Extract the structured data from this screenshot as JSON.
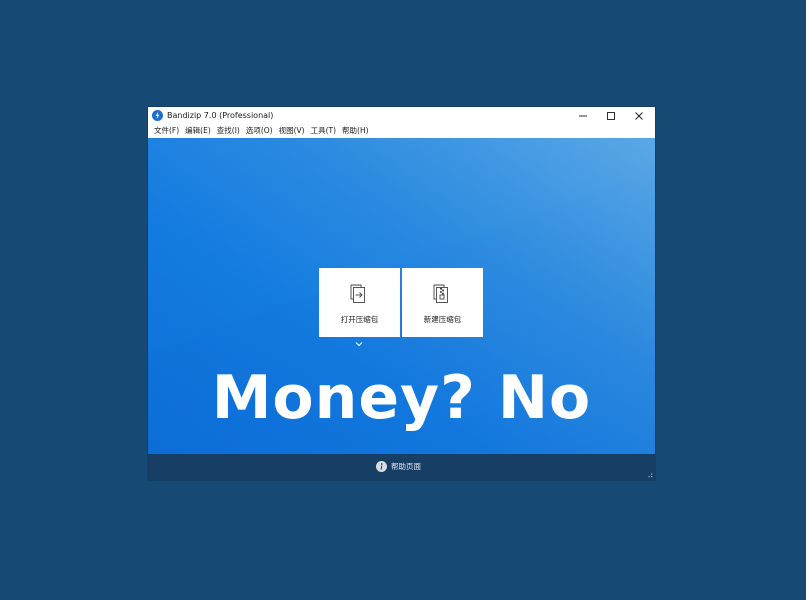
{
  "window": {
    "title": "Bandizip 7.0 (Professional)",
    "controls": {
      "minimize_icon": "minimize-icon",
      "maximize_icon": "maximize-icon",
      "close_icon": "close-icon"
    }
  },
  "menu": {
    "items": [
      {
        "label": "文件(F)"
      },
      {
        "label": "编辑(E)"
      },
      {
        "label": "查找(I)"
      },
      {
        "label": "选项(O)"
      },
      {
        "label": "视图(V)"
      },
      {
        "label": "工具(T)"
      },
      {
        "label": "帮助(H)"
      }
    ]
  },
  "main": {
    "tiles": [
      {
        "label": "打开压缩包",
        "icon": "open-archive-icon"
      },
      {
        "label": "新建压缩包",
        "icon": "new-archive-icon"
      }
    ],
    "more_icon": "chevron-down-icon",
    "overlay_text": "Money? No"
  },
  "footer": {
    "help_label": "帮助页面",
    "help_icon": "info-icon"
  },
  "colors": {
    "desktop": "#164a75",
    "content_gradient_start": "#5aa8e6",
    "content_gradient_end": "#0c6fd8",
    "footer": "#173f66",
    "app_icon": "#1a6fd1"
  }
}
